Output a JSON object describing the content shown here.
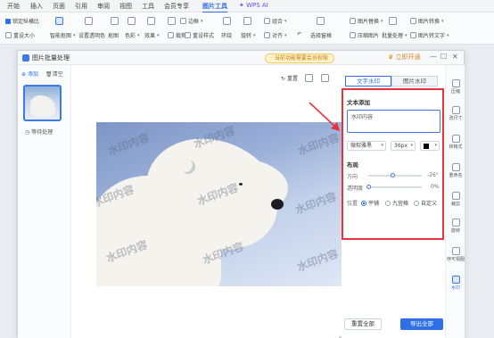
{
  "menubar": {
    "items": [
      "开始",
      "插入",
      "页面",
      "引用",
      "审阅",
      "视图",
      "工具",
      "会员专享",
      "图片工具",
      "WPS AI"
    ]
  },
  "ribbon": {
    "row1": [
      "锁定纵横比",
      "智能抠图",
      "设置透明色",
      "抠图",
      "色彩",
      "效果",
      "边框",
      "图片替换",
      "批量处理",
      "图片转换"
    ],
    "row2": [
      "重设大小",
      "裁剪",
      "重设样式",
      "环绕",
      "旋转",
      "对齐",
      "组合",
      "选择窗格",
      "压缩图片",
      "图片转文字"
    ],
    "border_label": "边框"
  },
  "dialog": {
    "title": "图片批量处理",
    "notice": "· 当前功能需要会员权限",
    "vip": "立即开通",
    "left": {
      "add": "添加",
      "clear": "清空",
      "thumb_caption": "等待处理"
    },
    "canvas": {
      "reset": "重置"
    },
    "watermark_text": "水印内容",
    "tabs": [
      "文字水印",
      "图片水印"
    ],
    "panel": {
      "text_section": "文本添加",
      "input_value": "水印内容",
      "font": "微软雅黑",
      "size": "36px",
      "layout_section": "布局",
      "direction_label": "方向",
      "direction_value": "-26°",
      "direction_fraction": 0.45,
      "opacity_label": "透明度",
      "opacity_value": "0%",
      "opacity_fraction": 0.0,
      "position_label": "位置",
      "positions": [
        "平铺",
        "九宫格",
        "自定义"
      ],
      "selected_position": 0
    },
    "rightbar": [
      "压缩",
      "改尺寸",
      "转格式",
      "重命名",
      "裁剪",
      "旋转",
      "存可视图",
      "水印"
    ],
    "buttons": {
      "reset_all": "重置全部",
      "export_all": "导出全部"
    }
  },
  "colors": {
    "accent": "#2f6fe8",
    "highlight_box": "#e8323c"
  }
}
